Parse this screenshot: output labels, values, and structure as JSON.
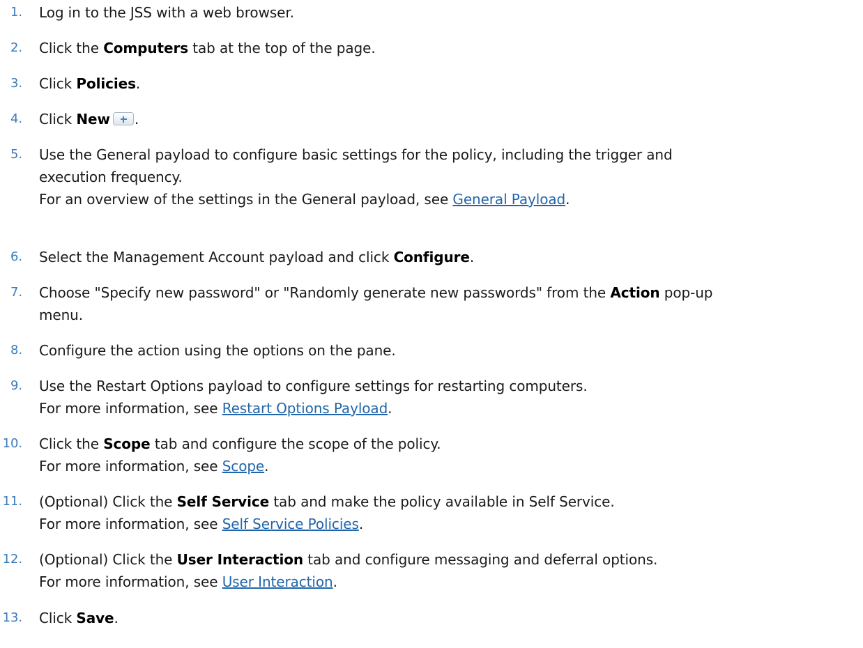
{
  "steps": [
    {
      "num": "1.",
      "parts": [
        "Log in to the JSS with a web browser."
      ]
    },
    {
      "num": "2.",
      "parts": [
        "Click the ",
        "Computers",
        " tab at the top of the page."
      ]
    },
    {
      "num": "3.",
      "parts": [
        "Click ",
        "Policies",
        "."
      ]
    },
    {
      "num": "4.",
      "parts": [
        "Click ",
        "New",
        "."
      ]
    },
    {
      "num": "5.",
      "lines": [
        "Use the General payload to configure basic settings for the policy, including the trigger and",
        "execution frequency."
      ],
      "sub": [
        "For an overview of the settings in the General payload, see ",
        "General Payload",
        "."
      ]
    },
    {
      "num": "6.",
      "parts": [
        "Select the Management Account payload and click ",
        "Configure",
        "."
      ]
    },
    {
      "num": "7.",
      "parts": [
        "Choose \"Specify new password\" or \"Randomly generate new passwords\" from the ",
        "Action",
        " pop-up"
      ],
      "cont": "menu."
    },
    {
      "num": "8.",
      "parts": [
        "Configure the action using the options on the pane."
      ]
    },
    {
      "num": "9.",
      "parts": [
        "Use the Restart Options payload to configure settings for restarting computers."
      ],
      "sub": [
        "For more information, see ",
        "Restart Options Payload",
        "."
      ]
    },
    {
      "num": "10.",
      "parts": [
        "Click the ",
        "Scope",
        " tab and configure the scope of the policy."
      ],
      "sub": [
        "For more information, see ",
        "Scope",
        "."
      ]
    },
    {
      "num": "11.",
      "parts": [
        "(Optional) Click the ",
        "Self Service",
        " tab and make the policy available in Self Service."
      ],
      "sub": [
        "For more information, see ",
        "Self Service Policies",
        "."
      ]
    },
    {
      "num": "12.",
      "parts": [
        "(Optional) Click the ",
        "User Interaction",
        " tab and configure messaging and deferral options."
      ],
      "sub": [
        "For more information, see ",
        "User Interaction",
        "."
      ]
    },
    {
      "num": "13.",
      "parts": [
        "Click ",
        "Save",
        "."
      ]
    }
  ],
  "icons": {
    "new_button": "plus-icon"
  },
  "colors": {
    "number": "#3a7bbd",
    "link": "#2166ab"
  }
}
